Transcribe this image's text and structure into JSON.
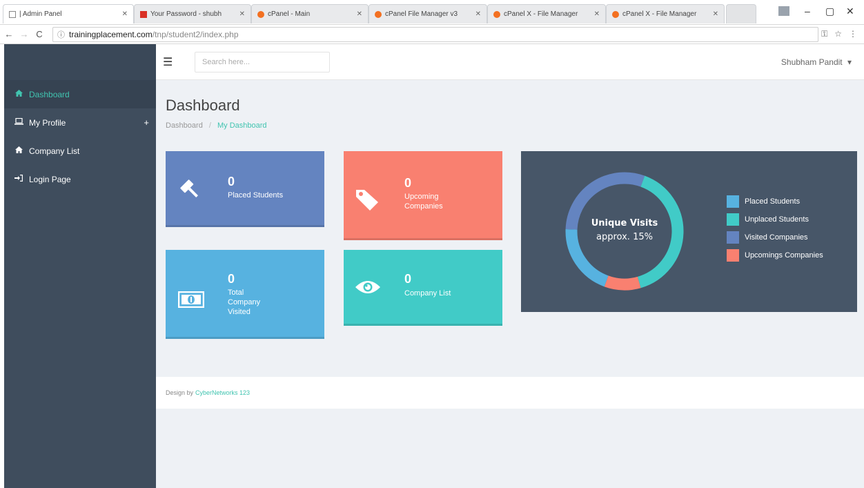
{
  "browser": {
    "tabs": [
      {
        "title": "| Admin Panel",
        "icon": "page-icon",
        "color": "#9e9e9e"
      },
      {
        "title": "Your Password - shubh",
        "icon": "gmail-icon",
        "color": "#d93025"
      },
      {
        "title": "cPanel - Main",
        "icon": "cpanel-icon",
        "color": "#f37021"
      },
      {
        "title": "cPanel File Manager v3",
        "icon": "cpanel-icon",
        "color": "#f37021"
      },
      {
        "title": "cPanel X - File Manager",
        "icon": "cpanel-icon",
        "color": "#f37021"
      },
      {
        "title": "cPanel X - File Manager",
        "icon": "cpanel-icon",
        "color": "#f37021"
      }
    ],
    "url_host": "trainingplacement.com",
    "url_path": "/tnp/student2/index.php"
  },
  "sidebar": {
    "items": [
      {
        "label": "Dashboard",
        "icon": "home-icon",
        "active": true
      },
      {
        "label": "My Profile",
        "icon": "laptop-icon",
        "has_submenu": true
      },
      {
        "label": "Company List",
        "icon": "home-icon"
      },
      {
        "label": "Login Page",
        "icon": "sign-in-icon"
      }
    ]
  },
  "topbar": {
    "search_placeholder": "Search here...",
    "user_name": "Shubham Pandit",
    "user_caret": "▾"
  },
  "page": {
    "title": "Dashboard",
    "breadcrumb_root": "Dashboard",
    "breadcrumb_sep": "/",
    "breadcrumb_current": "My Dashboard"
  },
  "cards": [
    {
      "value": "0",
      "label": "Placed Students",
      "icon": "gavel-icon",
      "color": "#6484c0"
    },
    {
      "value": "0",
      "label": "Upcoming Companies",
      "icon": "tag-icon",
      "color": "#f98070"
    },
    {
      "value": "0",
      "label": "Total Company Visited",
      "icon": "money-icon",
      "color": "#57b2e0"
    },
    {
      "value": "0",
      "label": "Company List",
      "icon": "eye-icon",
      "color": "#41cbc7"
    }
  ],
  "chart": {
    "center_title": "Unique Visits",
    "center_subtitle": "approx. 15%",
    "legend": [
      {
        "label": "Placed Students",
        "color": "#57b2e0"
      },
      {
        "label": "Unplaced Students",
        "color": "#41cbc7"
      },
      {
        "label": "Visited Companies",
        "color": "#6484c0"
      },
      {
        "label": "Upcomings Companies",
        "color": "#f98070"
      }
    ]
  },
  "chart_data": {
    "type": "pie",
    "title": "Unique Visits",
    "subtitle": "approx. 15%",
    "categories": [
      "Placed Students",
      "Unplaced Students",
      "Visited Companies",
      "Upcomings Companies"
    ],
    "values": [
      20,
      40,
      30,
      10
    ],
    "colors": [
      "#57b2e0",
      "#41cbc7",
      "#6484c0",
      "#f98070"
    ],
    "legend_position": "right"
  },
  "footer": {
    "text": "Design by",
    "link": "CyberNetworks 123"
  }
}
